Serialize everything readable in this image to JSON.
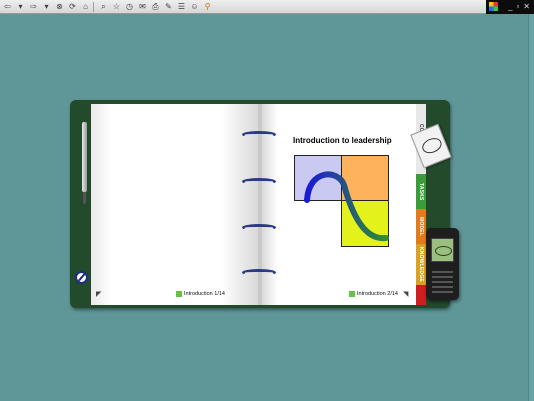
{
  "toolbar": {
    "icons": [
      "back-arrow-icon",
      "dropdown-icon",
      "forward-arrow-icon",
      "dropdown-icon",
      "stop-icon",
      "refresh-icon",
      "home-icon",
      "search-icon",
      "favorites-icon",
      "history-icon",
      "mail-icon",
      "print-icon",
      "edit-icon",
      "discuss-icon",
      "messenger-icon",
      "research-icon"
    ],
    "window_controls": [
      "_",
      "▫",
      "✕"
    ]
  },
  "page_left": {
    "footer_label": "Introduction 1/14"
  },
  "page_right": {
    "title": "Introduction to leadership",
    "footer_label": "Introduction 2/14"
  },
  "tabs": [
    {
      "label": "CONTENTS",
      "color": "#e8e8e8"
    },
    {
      "label": "TASKS",
      "color": "#3a9c3a"
    },
    {
      "label": "MODEL",
      "color": "#e37b1c"
    },
    {
      "label": "KNOWLEDGE",
      "color": "#d9a322"
    },
    {
      "label": "",
      "color": "#d01d1d"
    }
  ],
  "colors": {
    "quadrant_lavender": "#c9c9f2",
    "quadrant_orange": "#ffb25c",
    "quadrant_yellow": "#e2f21a",
    "curve_start": "#1a1ad6",
    "curve_end": "#2f8f2f",
    "accent_green": "#67c441"
  }
}
